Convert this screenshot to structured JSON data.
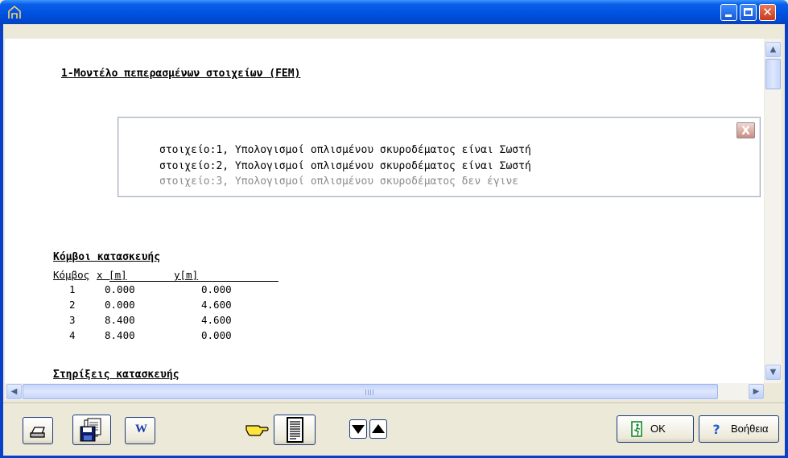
{
  "window": {
    "controls": [
      "minimize-icon",
      "maximize-icon",
      "close-icon"
    ]
  },
  "document": {
    "section_fem_title": "1-Μοντέλο πεπερασμένων στοιχείων (FEM)",
    "messages": [
      "στοιχείο:1, Υπολογισμοί οπλισμένου σκυροδέματος είναι Σωστή",
      "στοιχείο:2, Υπολογισμοί οπλισμένου σκυροδέματος είναι Σωστή",
      "στοιχείο:3, Υπολογισμοί οπλισμένου σκυροδέματος δεν έγινε"
    ],
    "message_close_label": "X",
    "nodes_title": "Κόμβοι κατασκευής",
    "nodes_table": {
      "headers": [
        "Κόμβος",
        "x [m]",
        "y[m]"
      ],
      "rows": [
        [
          "1",
          "0.000",
          "0.000"
        ],
        [
          "2",
          "0.000",
          "4.600"
        ],
        [
          "3",
          "8.400",
          "4.600"
        ],
        [
          "4",
          "8.400",
          "0.000"
        ]
      ]
    },
    "supports_title": "Στηρίξεις κατασκευής"
  },
  "toolbar": {
    "word_label": "W",
    "ok_label": "OK",
    "help_label": "Βοήθεια"
  },
  "colors": {
    "titlebar": "#0054e3",
    "window_bg": "#ece9d8",
    "disabled_text": "#8b8b8b"
  }
}
